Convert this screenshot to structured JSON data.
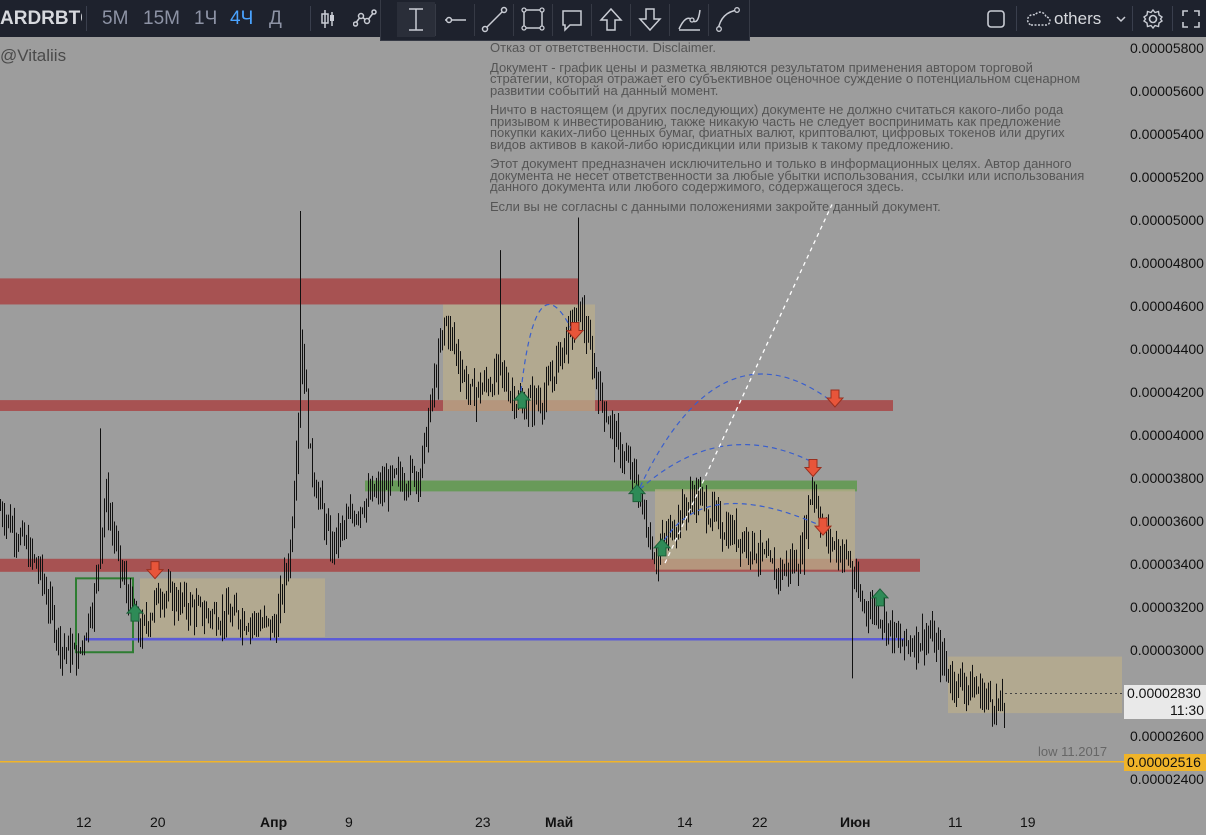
{
  "toolbar": {
    "symbol": "ARDRBTC",
    "intervals": [
      "5M",
      "15M",
      "1Ч",
      "4Ч",
      "Д"
    ],
    "active_interval": "4Ч",
    "others_label": "others",
    "icons": [
      "bar-style-icon",
      "indicators-icon",
      "crosshair-text-icon",
      "horizontal-line-icon",
      "trend-line-icon",
      "rectangle-icon",
      "callout-icon",
      "arrow-up-icon",
      "arrow-down-icon",
      "path-icon",
      "curve-icon",
      "fullscreen-box-icon",
      "cloud-icon",
      "settings-icon",
      "expand-icon"
    ]
  },
  "watermark": "@Vitaliis",
  "disclaimer": [
    "Отказ от ответственности. Disclaimer.",
    "Документ - график цены и разметка являются результатом применения автором торговой стратегии, которая отражает его субъективное оценочное суждение о потенциальном сценарном развитии событий на данный момент.",
    "Ничто в настоящем (и других последующих) документе не должно считаться какого-либо рода призывом к инвестированию, также никакую часть не следует воспринимать как предложение покупки каких-либо ценных бумаг, фиатных валют, криптовалют, цифровых токенов или других видов активов в какой-либо юрисдикции или призыв к такому предложению.",
    "Этот документ предназначен исключительно и только в информационных целях. Автор данного документа не несет ответственности за любые убытки использования, ссылки или использования данного документа или любого содержимого, содержащегося здесь.",
    "Если вы не согласны с данными положениями закройте данный документ."
  ],
  "price_axis": {
    "ticks": [
      "0.00005800",
      "0.00005600",
      "0.00005400",
      "0.00005200",
      "0.00005000",
      "0.00004800",
      "0.00004600",
      "0.00004400",
      "0.00004200",
      "0.00004000",
      "0.00003800",
      "0.00003600",
      "0.00003400",
      "0.00003200",
      "0.00003000",
      "0.00002600",
      "0.00002400"
    ],
    "current_price": "0.00002830",
    "countdown": "11:30",
    "low_price": "0.00002516",
    "low_label": "low 11.2017"
  },
  "time_axis": [
    "12",
    "20",
    "Апр",
    "9",
    "23",
    "Май",
    "14",
    "22",
    "Июн",
    "11",
    "19"
  ],
  "colors": {
    "background": "#9d9d9d",
    "toolbar": "#1e222d",
    "resistance_zone": "#a94a4a",
    "support_zone": "#5f9a4e",
    "range_box": "#b9ad8c",
    "support_line": "#5b5bd6",
    "low_line": "#f0b429",
    "candles": "#111111",
    "arrow_up": "#2e8b57",
    "arrow_down": "#e8553a",
    "projection": "#3a5fcd"
  },
  "chart_data": {
    "type": "candlestick",
    "yrange": [
      2.34e-05,
      5.82e-05
    ],
    "levels": {
      "resistance_zones": [
        [
          4.62e-05,
          4.74e-05
        ],
        [
          4.13e-05,
          4.18e-05
        ],
        [
          3.39e-05,
          3.45e-05
        ]
      ],
      "support_zone": [
        3.76e-05,
        3.81e-05
      ],
      "support_line": 3.08e-05,
      "low": 2.516e-05,
      "current": 2.83e-05
    },
    "price_path": [
      [
        0,
        3.68e-05
      ],
      [
        20,
        3.55e-05
      ],
      [
        40,
        3.38e-05
      ],
      [
        60,
        3.05e-05
      ],
      [
        78,
        3e-05
      ],
      [
        95,
        3.3e-05
      ],
      [
        105,
        3.75e-05
      ],
      [
        120,
        3.4e-05
      ],
      [
        140,
        3.1e-05
      ],
      [
        160,
        3.3e-05
      ],
      [
        200,
        3.2e-05
      ],
      [
        240,
        3.18e-05
      ],
      [
        275,
        3.13e-05
      ],
      [
        290,
        3.5e-05
      ],
      [
        302,
        4.45e-05
      ],
      [
        310,
        3.9e-05
      ],
      [
        330,
        3.5e-05
      ],
      [
        360,
        3.7e-05
      ],
      [
        390,
        3.8e-05
      ],
      [
        420,
        3.85e-05
      ],
      [
        432,
        4.2e-05
      ],
      [
        445,
        4.55e-05
      ],
      [
        470,
        4.2e-05
      ],
      [
        500,
        4.3e-05
      ],
      [
        520,
        4.15e-05
      ],
      [
        545,
        4.2e-05
      ],
      [
        560,
        4.4e-05
      ],
      [
        580,
        4.6e-05
      ],
      [
        600,
        4.2e-05
      ],
      [
        615,
        4e-05
      ],
      [
        635,
        3.8e-05
      ],
      [
        655,
        3.45e-05
      ],
      [
        672,
        3.6e-05
      ],
      [
        695,
        3.75e-05
      ],
      [
        720,
        3.6e-05
      ],
      [
        750,
        3.52e-05
      ],
      [
        775,
        3.38e-05
      ],
      [
        800,
        3.45e-05
      ],
      [
        812,
        3.8e-05
      ],
      [
        825,
        3.55e-05
      ],
      [
        848,
        3.45e-05
      ],
      [
        860,
        3.25e-05
      ],
      [
        880,
        3.2e-05
      ],
      [
        900,
        3.05e-05
      ],
      [
        930,
        3.1e-05
      ],
      [
        950,
        2.9e-05
      ],
      [
        975,
        2.85e-05
      ],
      [
        1005,
        2.75e-05
      ]
    ]
  }
}
